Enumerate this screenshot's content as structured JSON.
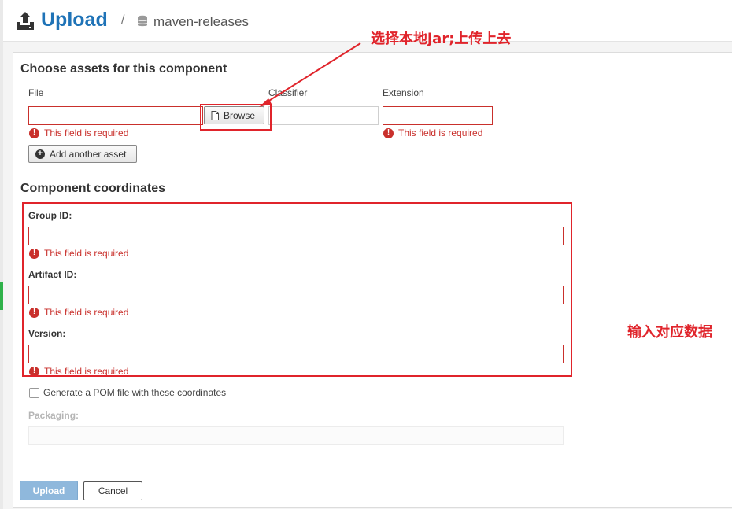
{
  "header": {
    "title": "Upload",
    "separator": "/",
    "repository": "maven-releases",
    "icons": {
      "upload": "upload-icon",
      "repository": "database-icon"
    }
  },
  "assets": {
    "heading": "Choose assets for this component",
    "columns": {
      "file": "File",
      "classifier": "Classifier",
      "extension": "Extension"
    },
    "browse_label": "Browse",
    "file_value": "",
    "classifier_value": "",
    "extension_value": "",
    "file_error": "This field is required",
    "extension_error": "This field is required",
    "add_asset_label": "Add another asset"
  },
  "coordinates": {
    "heading": "Component coordinates",
    "group_id": {
      "label": "Group ID:",
      "value": "",
      "error": "This field is required"
    },
    "artifact_id": {
      "label": "Artifact ID:",
      "value": "",
      "error": "This field is required"
    },
    "version": {
      "label": "Version:",
      "value": "",
      "error": "This field is required"
    },
    "generate_pom": {
      "label": "Generate a POM file with these coordinates",
      "checked": false
    },
    "packaging": {
      "label": "Packaging:",
      "value": ""
    }
  },
  "actions": {
    "upload": "Upload",
    "cancel": "Cancel"
  },
  "annotations": {
    "browse_note": "选择本地jar;上传上去",
    "fields_note": "输入对应数据",
    "color": "#e0242b"
  },
  "colors": {
    "accent": "#1f73b7",
    "error": "#c9302c",
    "primary_disabled": "#8fb8dc"
  }
}
